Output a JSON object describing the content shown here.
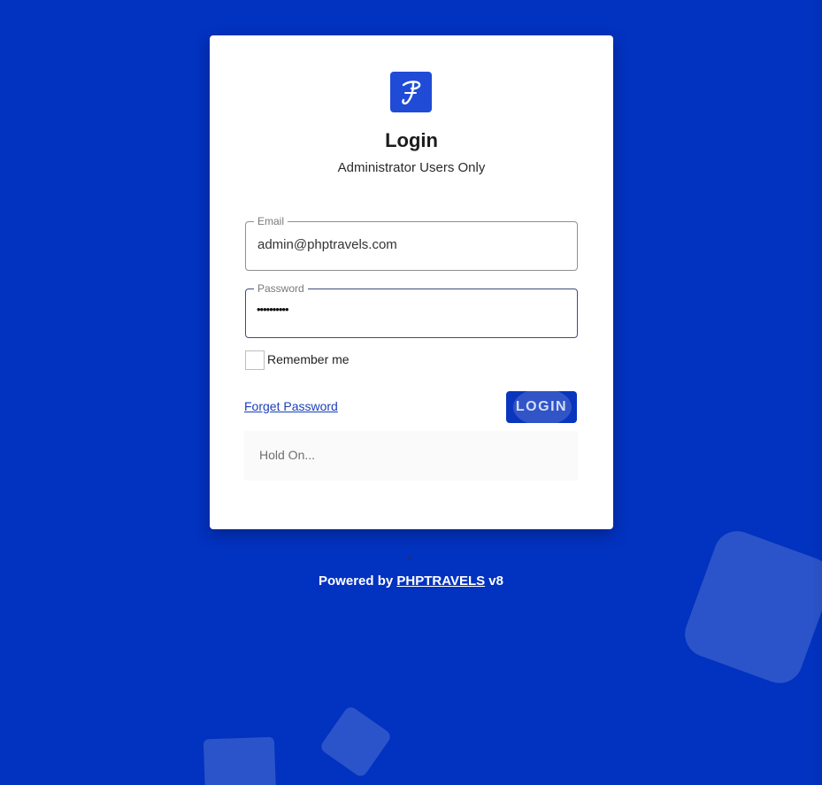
{
  "login": {
    "title": "Login",
    "subtitle": "Administrator Users Only",
    "email": {
      "label": "Email",
      "value": "admin@phptravels.com"
    },
    "password": {
      "label": "Password",
      "masked_value": "••••••••••"
    },
    "remember_label": "Remember me",
    "forget_label": "Forget Password",
    "submit_label": "LOGIN",
    "status_text": "Hold On..."
  },
  "footer": {
    "caret": "<",
    "powered_prefix": "Powered by",
    "brand": "PHPTRAVELS",
    "version": "v8"
  },
  "colors": {
    "background": "#0232c0",
    "card": "#ffffff",
    "accent": "#1f4bd6",
    "button": "#0a35bd",
    "link": "#1a3fb8"
  },
  "icons": {
    "logo": "phptravels-logo-icon"
  }
}
